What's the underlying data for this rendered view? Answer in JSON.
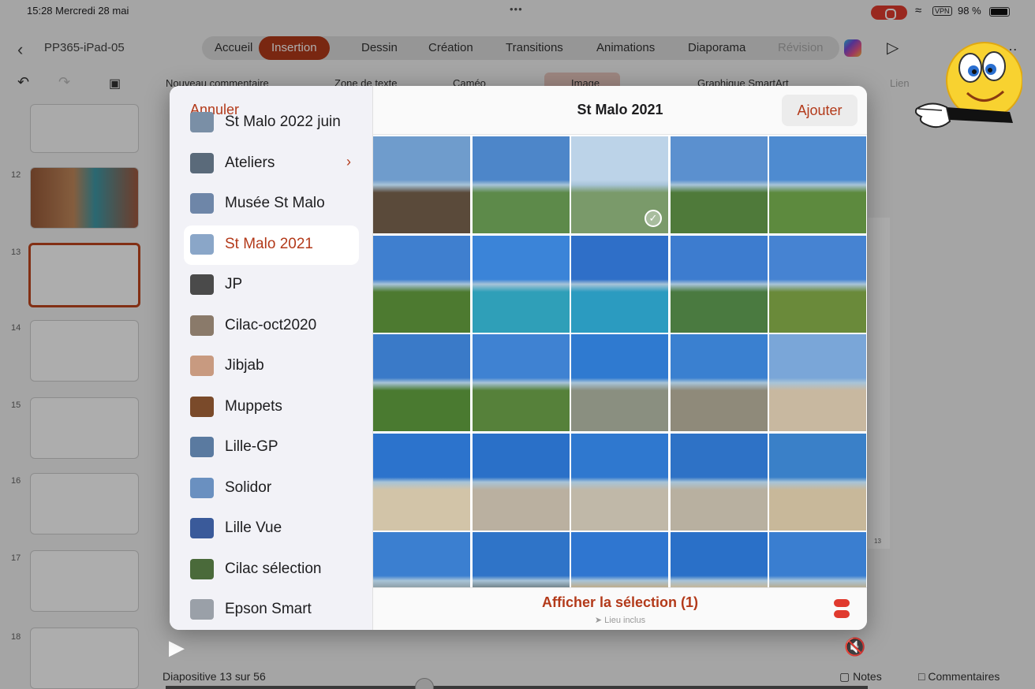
{
  "status_bar": {
    "time": "15:28  Mercredi 28 mai",
    "battery": "98 %",
    "vpn": "VPN",
    "dots": "•••"
  },
  "ribbon": {
    "document_name": "PP365-iPad-05",
    "tabs": [
      {
        "label": "Accueil"
      },
      {
        "label": "Insertion",
        "active": true
      },
      {
        "label": "Dessin"
      },
      {
        "label": "Création"
      },
      {
        "label": "Transitions"
      },
      {
        "label": "Animations"
      },
      {
        "label": "Diaporama"
      },
      {
        "label": "Révision"
      }
    ]
  },
  "toolbar": {
    "new_comment": "Nouveau commentaire",
    "text_box": "Zone de texte",
    "cameo": "Caméo",
    "image": "Image",
    "smartart": "Graphique SmartArt",
    "link": "Lien"
  },
  "slides": [
    {
      "number": "12"
    },
    {
      "number": "13",
      "selected": true
    },
    {
      "number": "14"
    },
    {
      "number": "15"
    },
    {
      "number": "16"
    },
    {
      "number": "17"
    },
    {
      "number": "18"
    }
  ],
  "editor": {
    "page_number": "13"
  },
  "bottom_bar": {
    "slide_info": "Diapositive 13 sur 56",
    "notes": "Notes",
    "comments": "Commentaires"
  },
  "picker": {
    "cancel": "Annuler",
    "title": "St Malo 2021",
    "add": "Ajouter",
    "albums": [
      {
        "label": "St Malo 2022 juin",
        "color": "#7a8fa6"
      },
      {
        "label": "Ateliers",
        "color": "#5a6a7a",
        "has_children": true
      },
      {
        "label": "Musée St Malo",
        "color": "#6e86a8"
      },
      {
        "label": "St Malo 2021",
        "color": "#8aa6c8",
        "active": true
      },
      {
        "label": "JP",
        "color": "#4a4a4a"
      },
      {
        "label": "Cilac-oct2020",
        "color": "#8a7a6a"
      },
      {
        "label": "Jibjab",
        "color": "#c89a80"
      },
      {
        "label": "Muppets",
        "color": "#7a4a2a"
      },
      {
        "label": "Lille-GP",
        "color": "#5a7aa0"
      },
      {
        "label": "Solidor",
        "color": "#6a90c0"
      },
      {
        "label": "Lille Vue",
        "color": "#3a5a9a"
      },
      {
        "label": "Cilac sélection",
        "color": "#4a6a3a"
      },
      {
        "label": "Epson Smart",
        "color": "#9aa0a8"
      }
    ],
    "photos": [
      {
        "sky": "#6f9ccc",
        "land": "#5a4a3a",
        "selected": false
      },
      {
        "sky": "#4d86c9",
        "land": "#5d8a4a",
        "selected": false
      },
      {
        "sky": "#bcd3e8",
        "land": "#7a9a6a",
        "selected": true
      },
      {
        "sky": "#5b90cf",
        "land": "#4f7a3a",
        "selected": false
      },
      {
        "sky": "#4e8bd0",
        "land": "#5d8a3e",
        "selected": false
      },
      {
        "sky": "#3f7fcf",
        "land": "#4d7a30",
        "selected": false
      },
      {
        "sky": "#3b84d8",
        "land": "#2f9fb8",
        "selected": false
      },
      {
        "sky": "#2f6fc8",
        "land": "#2b9bc0",
        "selected": false
      },
      {
        "sky": "#3d7ccf",
        "land": "#4a7a40",
        "selected": false
      },
      {
        "sky": "#4683d2",
        "land": "#6a8a3a",
        "selected": false
      },
      {
        "sky": "#3a7ac8",
        "land": "#4a7a30",
        "selected": false
      },
      {
        "sky": "#3f82d2",
        "land": "#56813a",
        "selected": false
      },
      {
        "sky": "#2f7ad0",
        "land": "#8a8f80",
        "selected": false
      },
      {
        "sky": "#3a80d0",
        "land": "#8f8a7a",
        "selected": false
      },
      {
        "sky": "#7aa6d8",
        "land": "#c8b8a0",
        "selected": false
      },
      {
        "sky": "#2c73cc",
        "land": "#d2c4a8",
        "selected": false
      },
      {
        "sky": "#2a70c8",
        "land": "#bab0a0",
        "selected": false
      },
      {
        "sky": "#2f78cf",
        "land": "#c0b8a8",
        "selected": false
      },
      {
        "sky": "#2e72c6",
        "land": "#b8b0a0",
        "selected": false
      },
      {
        "sky": "#3a80c8",
        "land": "#c8b89a",
        "selected": false
      },
      {
        "sky": "#3b7fd0",
        "land": "#8a9aa0",
        "selected": false
      },
      {
        "sky": "#2f74c8",
        "land": "#6a7a80",
        "selected": false
      },
      {
        "sky": "#2f76d0",
        "land": "#c0a880",
        "selected": false
      },
      {
        "sky": "#2a70c8",
        "land": "#c8b490",
        "selected": false
      },
      {
        "sky": "#3a7ed0",
        "land": "#b8a888",
        "selected": false
      }
    ],
    "show_selection": "Afficher la sélection (1)",
    "location_included": "Lieu inclus"
  },
  "colors": {
    "accent": "#b33a1a",
    "selected_slide_border": "#c0461e"
  },
  "icons": [
    "back-icon",
    "undo-icon",
    "redo-icon",
    "play-icon",
    "copilot-icon",
    "wifi-icon",
    "battery-icon",
    "location-arrow-icon",
    "options-toggle-icon",
    "mute-icon",
    "chevron-right-icon",
    "smiley-pointing-icon"
  ]
}
